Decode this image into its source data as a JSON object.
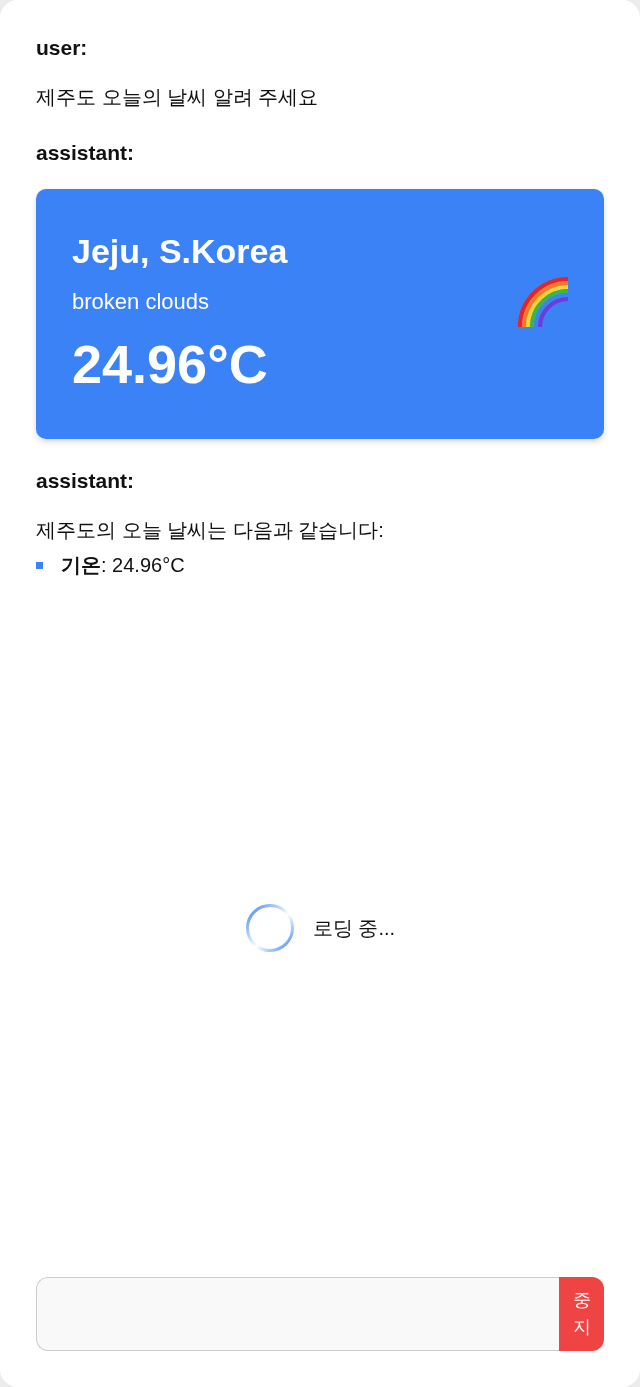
{
  "messages": [
    {
      "role": "user:",
      "kind": "text",
      "text": "제주도 오늘의 날씨 알려 주세요"
    },
    {
      "role": "assistant:",
      "kind": "weather",
      "city": "Jeju, S.Korea",
      "description": "broken clouds",
      "temperature": "24.96°C"
    },
    {
      "role": "assistant:",
      "kind": "list",
      "text": "제주도의 오늘 날씨는 다음과 같습니다:",
      "items": [
        "**기온**: 24.96°C"
      ]
    }
  ],
  "loading": {
    "text": "로딩 중..."
  },
  "composer": {
    "button": "중지"
  }
}
